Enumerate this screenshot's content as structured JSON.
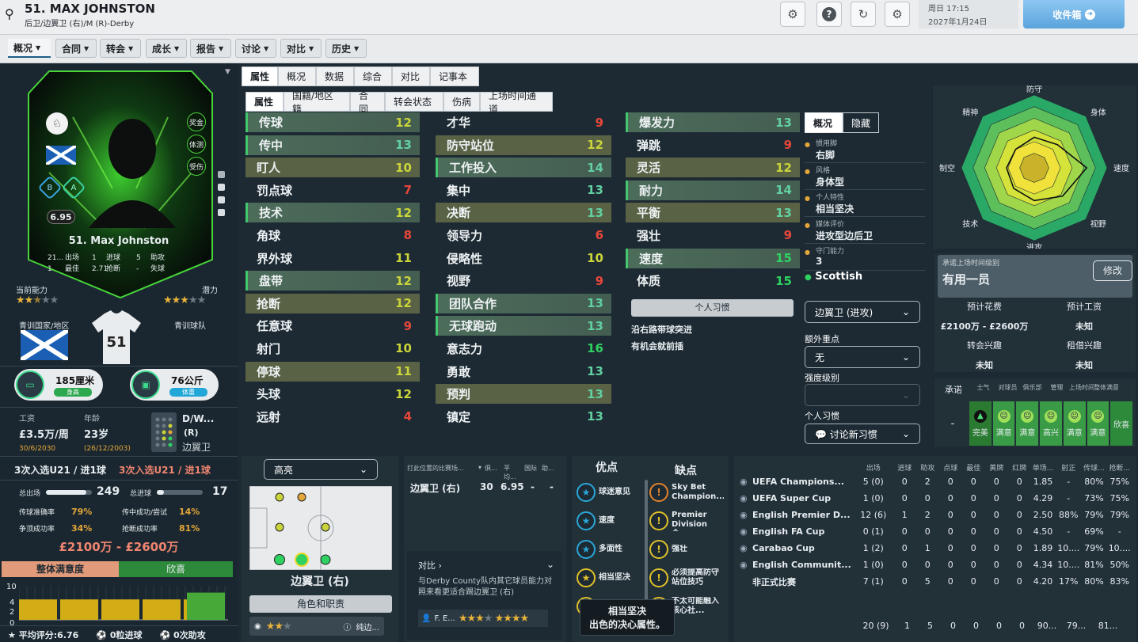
{
  "header": {
    "title": "51. MAX JOHNSTON",
    "subtitle": "后卫/边翼卫 (右)/M (R)-Derby",
    "date_line1": "周日 17:15",
    "date_line2": "2027年1月24日",
    "inbox_label": "收件箱"
  },
  "nav": {
    "tabs": [
      "概况",
      "合同",
      "转会",
      "成长",
      "报告",
      "讨论",
      "对比",
      "历史"
    ]
  },
  "card": {
    "name": "51. Max Johnston",
    "rating": "6.95",
    "badges": [
      "奖金",
      "体测",
      "受伤"
    ],
    "b_badge": "B",
    "a_badge": "A",
    "stats": [
      {
        "v1": "21...",
        "l1": "出场",
        "v2": "1",
        "l2": "进球",
        "v3": "5",
        "l3": "助攻"
      },
      {
        "v1": "1",
        "l1": "最佳",
        "v2": "2.71",
        "l2": "抢断",
        "v3": "-",
        "l3": "失球"
      }
    ]
  },
  "left": {
    "ca_label": "当前能力",
    "pa_label": "潜力",
    "ca_stars": 2.5,
    "pa_stars": 3,
    "youth_nation_label": "青训国家/地区",
    "youth_club_label": "青训球队",
    "shirt_number": "51",
    "height": "185厘米",
    "height_tag": "身高",
    "weight": "76公斤",
    "weight_tag": "体重",
    "wage_label": "工资",
    "wage": "£3.5万/周",
    "wage_date": "30/6/2030",
    "age_label": "年龄",
    "age": "23岁",
    "dob": "(26/12/2003)",
    "position_short": "D/W...",
    "position_side": "(R)",
    "position_name": "边翼卫",
    "u21_white": "3次入选U21 / 进1球",
    "u21_red": "3次入选U21 / 进1球",
    "apps_label": "总出场",
    "apps": "249",
    "goals_label": "总进球",
    "goals": "17",
    "apps_fill": 0.88,
    "goals_fill": 0.15,
    "ratios": [
      {
        "l": "传球准确率",
        "v": "79%"
      },
      {
        "l": "传中成功/尝试",
        "v": "14%"
      },
      {
        "l": "争顶成功率",
        "v": "34%"
      },
      {
        "l": "抢断成功率",
        "v": "81%"
      }
    ],
    "value": "£2100万 - £2600万",
    "satisfaction_label": "整体满意度",
    "satisfaction_value": "欣喜",
    "hist_ticks": [
      "10",
      "4",
      "2",
      "0"
    ],
    "hist_values": [
      6,
      6,
      6,
      6,
      6,
      8
    ],
    "footer": [
      {
        "l": "平均评分:6.76"
      },
      {
        "l": "0粒进球"
      },
      {
        "l": "0次助攻"
      }
    ]
  },
  "subtabs1": [
    "属性",
    "概况",
    "数据",
    "综合",
    "对比",
    "记事本"
  ],
  "subtabs2": [
    "属性",
    "国籍/地区籍",
    "合同",
    "转会状态",
    "伤病",
    "上场时间通道"
  ],
  "attrs_col1": [
    {
      "n": "传球",
      "v": "12",
      "c": "vy",
      "s": "hl"
    },
    {
      "n": "传中",
      "v": "13",
      "c": "vb",
      "s": "hl"
    },
    {
      "n": "盯人",
      "v": "10",
      "c": "vy",
      "s": "alt"
    },
    {
      "n": "罚点球",
      "v": "7",
      "c": "vr",
      "s": ""
    },
    {
      "n": "技术",
      "v": "12",
      "c": "vy",
      "s": "hl"
    },
    {
      "n": "角球",
      "v": "8",
      "c": "vr",
      "s": ""
    },
    {
      "n": "界外球",
      "v": "11",
      "c": "vy",
      "s": ""
    },
    {
      "n": "盘带",
      "v": "12",
      "c": "vy",
      "s": "hl"
    },
    {
      "n": "抢断",
      "v": "12",
      "c": "vy",
      "s": "alt"
    },
    {
      "n": "任意球",
      "v": "9",
      "c": "vr",
      "s": ""
    },
    {
      "n": "射门",
      "v": "10",
      "c": "vy",
      "s": ""
    },
    {
      "n": "停球",
      "v": "11",
      "c": "vy",
      "s": "alt"
    },
    {
      "n": "头球",
      "v": "12",
      "c": "vy",
      "s": ""
    },
    {
      "n": "远射",
      "v": "4",
      "c": "vr",
      "s": ""
    }
  ],
  "attrs_col2": [
    {
      "n": "才华",
      "v": "9",
      "c": "vr",
      "s": ""
    },
    {
      "n": "防守站位",
      "v": "12",
      "c": "vy",
      "s": "alt"
    },
    {
      "n": "工作投入",
      "v": "14",
      "c": "vb",
      "s": "hl"
    },
    {
      "n": "集中",
      "v": "13",
      "c": "vb",
      "s": ""
    },
    {
      "n": "决断",
      "v": "13",
      "c": "vb",
      "s": "alt"
    },
    {
      "n": "领导力",
      "v": "6",
      "c": "vr",
      "s": ""
    },
    {
      "n": "侵略性",
      "v": "10",
      "c": "vy",
      "s": ""
    },
    {
      "n": "视野",
      "v": "9",
      "c": "vr",
      "s": ""
    },
    {
      "n": "团队合作",
      "v": "13",
      "c": "vb",
      "s": "hl"
    },
    {
      "n": "无球跑动",
      "v": "13",
      "c": "vb",
      "s": "hl"
    },
    {
      "n": "意志力",
      "v": "16",
      "c": "vg",
      "s": ""
    },
    {
      "n": "勇敢",
      "v": "13",
      "c": "vb",
      "s": ""
    },
    {
      "n": "预判",
      "v": "13",
      "c": "vb",
      "s": "alt"
    },
    {
      "n": "镇定",
      "v": "13",
      "c": "vb",
      "s": ""
    }
  ],
  "attrs_col3": [
    {
      "n": "爆发力",
      "v": "13",
      "c": "vb",
      "s": "hl"
    },
    {
      "n": "弹跳",
      "v": "9",
      "c": "vr",
      "s": ""
    },
    {
      "n": "灵活",
      "v": "12",
      "c": "vy",
      "s": "alt"
    },
    {
      "n": "耐力",
      "v": "14",
      "c": "vb",
      "s": "hl"
    },
    {
      "n": "平衡",
      "v": "13",
      "c": "vb",
      "s": "alt"
    },
    {
      "n": "强壮",
      "v": "9",
      "c": "vr",
      "s": ""
    },
    {
      "n": "速度",
      "v": "15",
      "c": "vg",
      "s": "hl"
    },
    {
      "n": "体质",
      "v": "15",
      "c": "vg",
      "s": ""
    }
  ],
  "habits": {
    "title": "个人习惯",
    "items": [
      "沿右路带球突进",
      "有机会就前插"
    ]
  },
  "info": {
    "tabs": [
      "概况",
      "隐藏"
    ],
    "rows": [
      {
        "k": "惯用脚",
        "v": "右脚"
      },
      {
        "k": "风格",
        "v": "身体型"
      },
      {
        "k": "个人特性",
        "v": "相当坚决"
      },
      {
        "k": "媒体评价",
        "v": "进攻型边后卫"
      },
      {
        "k": "守门能力",
        "v": "3"
      }
    ],
    "nation": "Scottish",
    "role": "边翼卫 (进攻)",
    "extra_label": "额外重点",
    "extra": "无",
    "intensity_label": "强度级别",
    "intensity": "",
    "habit_label": "个人习惯",
    "habit_btn": "讨论新习惯"
  },
  "radar": {
    "labels": [
      "防守",
      "身体",
      "速度",
      "视野",
      "进攻",
      "技术",
      "制空",
      "精神"
    ]
  },
  "playtime": {
    "label": "承诺上场时间级别",
    "value": "有用一员",
    "edit": "修改",
    "fee_label": "预计花费",
    "wage_label": "预计工资",
    "fee": "£2100万 - £2600万",
    "wage": "未知",
    "transfer_label": "转会兴趣",
    "loan_label": "租借兴趣",
    "transfer": "未知",
    "loan": "未知"
  },
  "happiness": {
    "headers": [
      "承诺",
      "士气",
      "对球员",
      "俱乐部",
      "管理",
      "上场时间",
      "整体满意度"
    ],
    "promise": "-",
    "cells": [
      "完美",
      "满意",
      "满意",
      "高兴",
      "满意",
      "满意",
      "欣喜"
    ]
  },
  "pitch": {
    "dropdown": "高亮",
    "position": "边翼卫 (右)",
    "role_btn": "角色和职责",
    "role_row": "纯边..."
  },
  "posstats": {
    "headers": [
      "打此位置的比赛场...",
      "俱...",
      "平均...",
      "国际",
      "助..."
    ],
    "row": [
      "边翼卫 (右)",
      "30",
      "6.95",
      "-",
      "-"
    ],
    "compare_label": "对比",
    "compare_text": "与Derby County队内其它球员能力对照来看更适合踢边翼卫 (右)",
    "cmp_player": "F. E..."
  },
  "traits": {
    "pros_title": "优点",
    "cons_title": "缺点",
    "pros": [
      "球迷意见",
      "速度",
      "多面性",
      "相当坚决",
      "速度"
    ],
    "cons": [
      "Sky Bet Champion...",
      "Premier Division合...",
      "强壮",
      "必须提高防守站位技巧",
      "不太可能融入核心社..."
    ],
    "tooltip_title": "相当坚决",
    "tooltip_text": "出色的决心属性。"
  },
  "career": {
    "headers": [
      "出场",
      "进球",
      "助攻",
      "点球",
      "最佳",
      "黄牌",
      "红牌",
      "单场...",
      "射正",
      "传球...",
      "抢断..."
    ],
    "rows": [
      {
        "n": "UEFA Champions...",
        "c": [
          "5 (0)",
          "0",
          "2",
          "0",
          "0",
          "0",
          "0",
          "1.85",
          "-",
          "80%",
          "75%"
        ]
      },
      {
        "n": "UEFA Super Cup",
        "c": [
          "1 (0)",
          "0",
          "0",
          "0",
          "0",
          "0",
          "0",
          "4.29",
          "-",
          "73%",
          "75%"
        ]
      },
      {
        "n": "English Premier D...",
        "c": [
          "12 (6)",
          "1",
          "2",
          "0",
          "0",
          "0",
          "0",
          "2.50",
          "88%",
          "79%",
          "79%"
        ]
      },
      {
        "n": "English FA Cup",
        "c": [
          "0 (1)",
          "0",
          "0",
          "0",
          "0",
          "0",
          "0",
          "4.50",
          "-",
          "69%",
          "-"
        ]
      },
      {
        "n": "Carabao Cup",
        "c": [
          "1 (2)",
          "0",
          "1",
          "0",
          "0",
          "0",
          "0",
          "1.89",
          "10....",
          "79%",
          "10...."
        ]
      },
      {
        "n": "English Communit...",
        "c": [
          "1 (0)",
          "0",
          "0",
          "0",
          "0",
          "0",
          "0",
          "4.34",
          "10....",
          "81%",
          "50%"
        ]
      },
      {
        "n": "非正式比赛",
        "c": [
          "7 (1)",
          "0",
          "5",
          "0",
          "0",
          "0",
          "0",
          "4.20",
          "17%",
          "80%",
          "83%"
        ]
      }
    ],
    "totals": [
      "20 (9)",
      "1",
      "5",
      "0",
      "0",
      "0",
      "0",
      "90...",
      "79...",
      "81..."
    ]
  },
  "colors": {
    "accent": "#43c76d",
    "bg": "#1d2a33",
    "header": "#eceef0"
  }
}
